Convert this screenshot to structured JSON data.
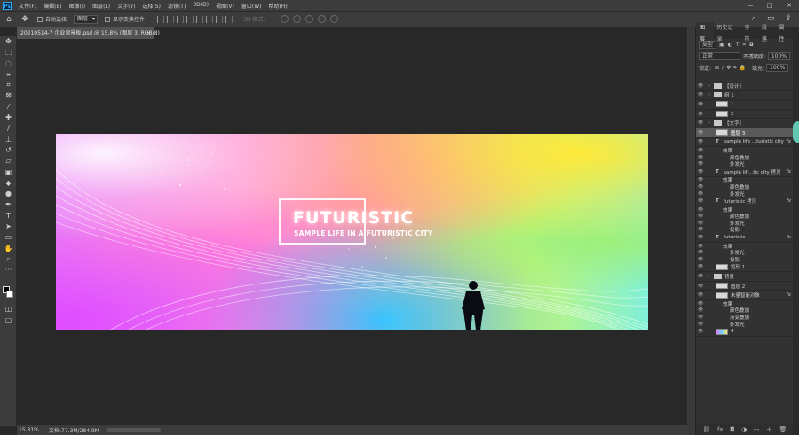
{
  "app": {
    "logo": "Ps"
  },
  "menu": [
    "文件(F)",
    "编辑(E)",
    "图像(I)",
    "图层(L)",
    "文字(Y)",
    "选择(S)",
    "滤镜(T)",
    "3D(D)",
    "视图(V)",
    "窗口(W)",
    "帮助(H)"
  ],
  "window_controls": [
    "—",
    "□",
    "✕"
  ],
  "options": {
    "auto_select_label": "自动选择:",
    "auto_select_value": "图层",
    "show_transform_label": "显示变换控件",
    "mode_3d_label": "3D 模式:"
  },
  "document": {
    "tab_title": "20210514-7 企业背景板.psd @ 15.8% (图层 3, RGB/8)",
    "close": "×"
  },
  "canvas_art": {
    "headline": "FUTURISTIC",
    "subline": "SAMPLE LIFE IN A FUTURISTIC CITY"
  },
  "status": {
    "zoom": "15.81%",
    "doc_size": "文档:77.3M/284.9M",
    "arrow": ">"
  },
  "panel": {
    "tabs": [
      "图层",
      "历史记录",
      "字符",
      "段落",
      "属性"
    ],
    "filter_value": "类型",
    "blend_mode": "正常",
    "opacity_label": "不透明度:",
    "opacity_value": "100%",
    "lock_label": "锁定:",
    "fill_label": "填充:",
    "fill_value": "100%"
  },
  "layers": [
    {
      "label": "【设计】",
      "kind": "folder",
      "indent": 0
    },
    {
      "label": "组 1",
      "kind": "folder",
      "indent": 0
    },
    {
      "label": "1",
      "kind": "thumb",
      "indent": 1
    },
    {
      "label": "2",
      "kind": "thumb",
      "indent": 1
    },
    {
      "label": "【文字】",
      "kind": "folder",
      "indent": 0
    },
    {
      "label": "图层 3",
      "kind": "thumb",
      "indent": 1,
      "selected": true
    },
    {
      "label": "sample life ...turistic city",
      "kind": "text",
      "indent": 1,
      "fx": "fx"
    },
    {
      "label": "效果",
      "kind": "effect",
      "indent": 2
    },
    {
      "label": "颜色叠加",
      "kind": "effect",
      "indent": 3
    },
    {
      "label": "外发光",
      "kind": "effect",
      "indent": 3
    },
    {
      "label": "sample lif....tic city 拷贝",
      "kind": "text",
      "indent": 1,
      "fx": "fx"
    },
    {
      "label": "效果",
      "kind": "effect",
      "indent": 2
    },
    {
      "label": "颜色叠加",
      "kind": "effect",
      "indent": 3
    },
    {
      "label": "外发光",
      "kind": "effect",
      "indent": 3
    },
    {
      "label": "futuristic 拷贝",
      "kind": "text",
      "indent": 1,
      "fx": "fx"
    },
    {
      "label": "效果",
      "kind": "effect",
      "indent": 2
    },
    {
      "label": "颜色叠加",
      "kind": "effect",
      "indent": 3
    },
    {
      "label": "外发光",
      "kind": "effect",
      "indent": 3
    },
    {
      "label": "投影",
      "kind": "effect",
      "indent": 3
    },
    {
      "label": "futuristic",
      "kind": "text",
      "indent": 1,
      "fx": "fx"
    },
    {
      "label": "效果",
      "kind": "effect",
      "indent": 2
    },
    {
      "label": "外发光",
      "kind": "effect",
      "indent": 3
    },
    {
      "label": "投影",
      "kind": "effect",
      "indent": 3
    },
    {
      "label": "矩形 1",
      "kind": "thumb",
      "indent": 1
    },
    {
      "label": "背景",
      "kind": "folder",
      "indent": 0
    },
    {
      "label": "图层 2",
      "kind": "thumb",
      "indent": 1
    },
    {
      "label": "未量智能对象",
      "kind": "thumb",
      "indent": 1,
      "fx": "fx"
    },
    {
      "label": "效果",
      "kind": "effect",
      "indent": 2
    },
    {
      "label": "颜色叠加",
      "kind": "effect",
      "indent": 3
    },
    {
      "label": "渐变叠加",
      "kind": "effect",
      "indent": 3
    },
    {
      "label": "外发光",
      "kind": "effect",
      "indent": 3
    },
    {
      "label": "4",
      "kind": "gradient",
      "indent": 1
    }
  ],
  "panel_footer": [
    "⛓",
    "fx",
    "◘",
    "◑",
    "▭",
    "＋",
    "🗑"
  ]
}
